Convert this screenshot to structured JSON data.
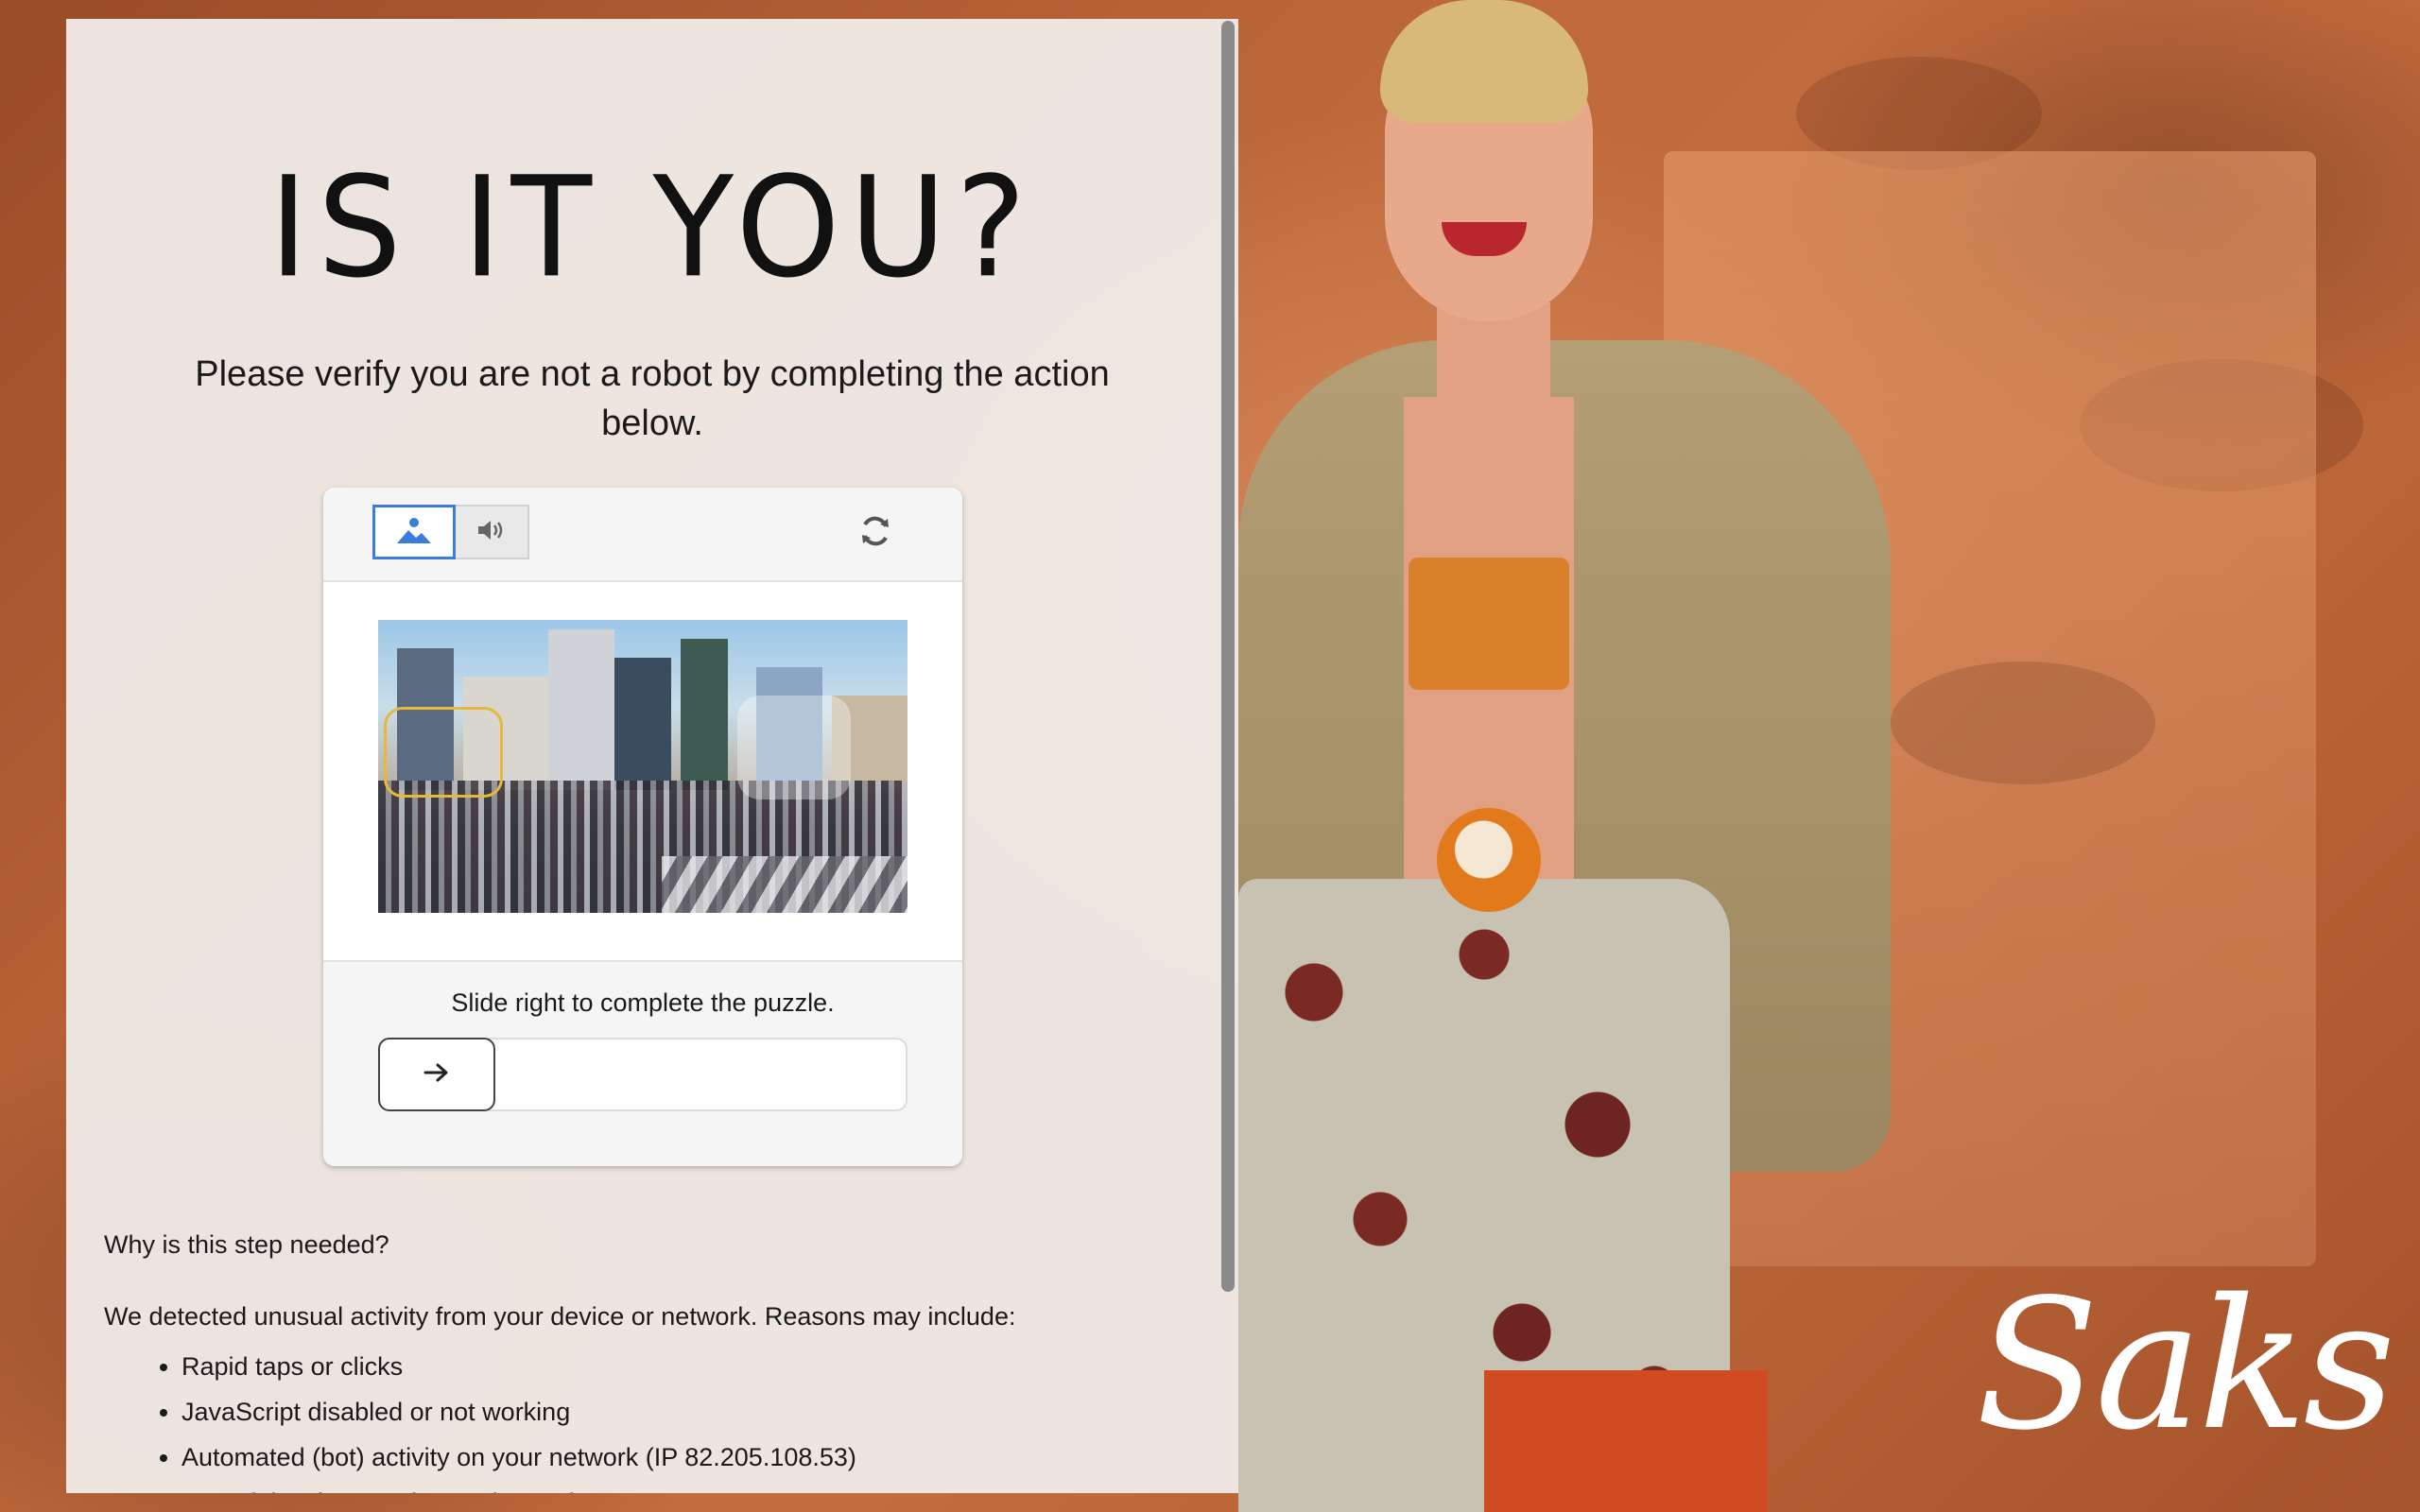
{
  "page": {
    "title": "IS IT YOU?",
    "subtitle": "Please verify you are not a robot by completing the action below."
  },
  "captcha": {
    "modes": [
      {
        "name": "image",
        "icon": "image-icon",
        "selected": true
      },
      {
        "name": "audio",
        "icon": "speaker-icon",
        "selected": false
      }
    ],
    "refresh_icon": "refresh-icon",
    "instruction": "Slide right to complete the puzzle.",
    "slider_icon": "arrow-right-icon"
  },
  "info": {
    "why_heading": "Why is this step needed?",
    "detected_text": "We detected unusual activity from your device or network. Reasons may include:",
    "reasons": [
      "Rapid taps or clicks",
      "JavaScript disabled or not working",
      "Automated (bot) activity on your network (IP 82.205.108.53)",
      "Use of developer or inspection tools"
    ]
  },
  "brand": {
    "logo_text": "Saks"
  },
  "colors": {
    "accent": "#3b7ddd",
    "puzzle_outline": "#e7b83a",
    "background": "#b4643a"
  }
}
